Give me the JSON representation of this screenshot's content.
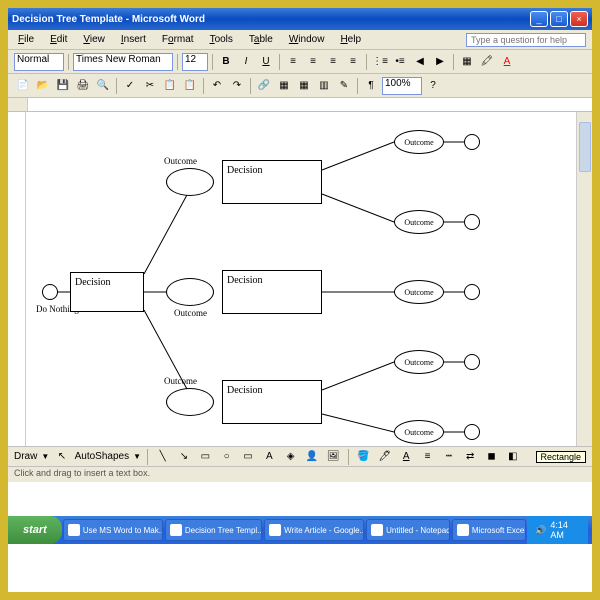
{
  "window": {
    "title": "Decision Tree Template - Microsoft Word",
    "help_placeholder": "Type a question for help"
  },
  "menus": {
    "file": "File",
    "edit": "Edit",
    "view": "View",
    "insert": "Insert",
    "format": "Format",
    "tools": "Tools",
    "table": "Table",
    "window": "Window",
    "help": "Help"
  },
  "formatting": {
    "style": "Normal",
    "font": "Times New Roman",
    "size": "12",
    "zoom": "100%"
  },
  "diagram": {
    "do_nothing": "Do Nothing",
    "decision1": "Decision",
    "outcome_top": "Outcome",
    "outcome_mid": "Outcome",
    "outcome_bot": "Outcome",
    "decision2": "Decision",
    "decision3": "Decision",
    "decision4": "Decision",
    "outcome_r1": "Outcome",
    "outcome_r2": "Outcome",
    "outcome_r3": "Outcome",
    "outcome_r4": "Outcome",
    "outcome_r5": "Outcome"
  },
  "draw_toolbar": {
    "draw": "Draw",
    "autoshapes": "AutoShapes",
    "hint": "Rectangle"
  },
  "status": {
    "text": "Click and drag to insert a text box."
  },
  "taskbar": {
    "start": "start",
    "task1": "Use MS Word to Mak...",
    "task2": "Decision Tree Templ...",
    "task3": "Write Article - Google...",
    "task4": "Untitled - Notepad",
    "task5": "Microsoft Excel",
    "time": "4:14 AM"
  }
}
